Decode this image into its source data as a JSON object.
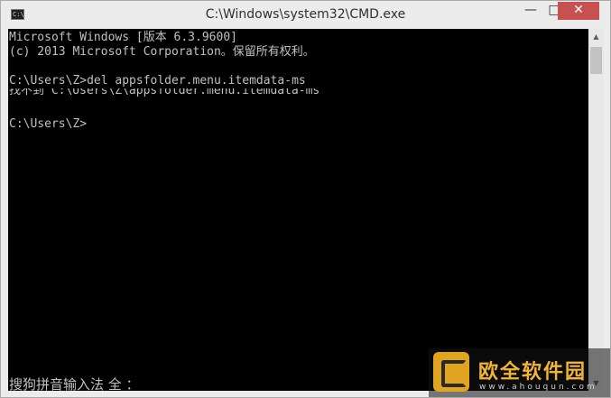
{
  "window": {
    "title": "C:\\Windows\\system32\\CMD.exe",
    "icon_text": "C:\\",
    "controls": {
      "minimize": "—",
      "maximize": "□",
      "close": "✕"
    }
  },
  "console": {
    "lines": [
      "Microsoft Windows [版本 6.3.9600]",
      "(c) 2013 Microsoft Corporation。保留所有权利。",
      "",
      "C:\\Users\\Z>del appsfolder.menu.itemdata-ms",
      "找不到 C:\\Users\\Z\\appsfolder.menu.itemdata-ms",
      "",
      "C:\\Users\\Z>"
    ],
    "ime_status": "搜狗拼音输入法 全 ："
  },
  "scrollbar": {
    "up_icon": "▲",
    "down_icon": "▼"
  },
  "watermark": {
    "title": "欧全软件园",
    "url": "www.ahouqun.com"
  }
}
